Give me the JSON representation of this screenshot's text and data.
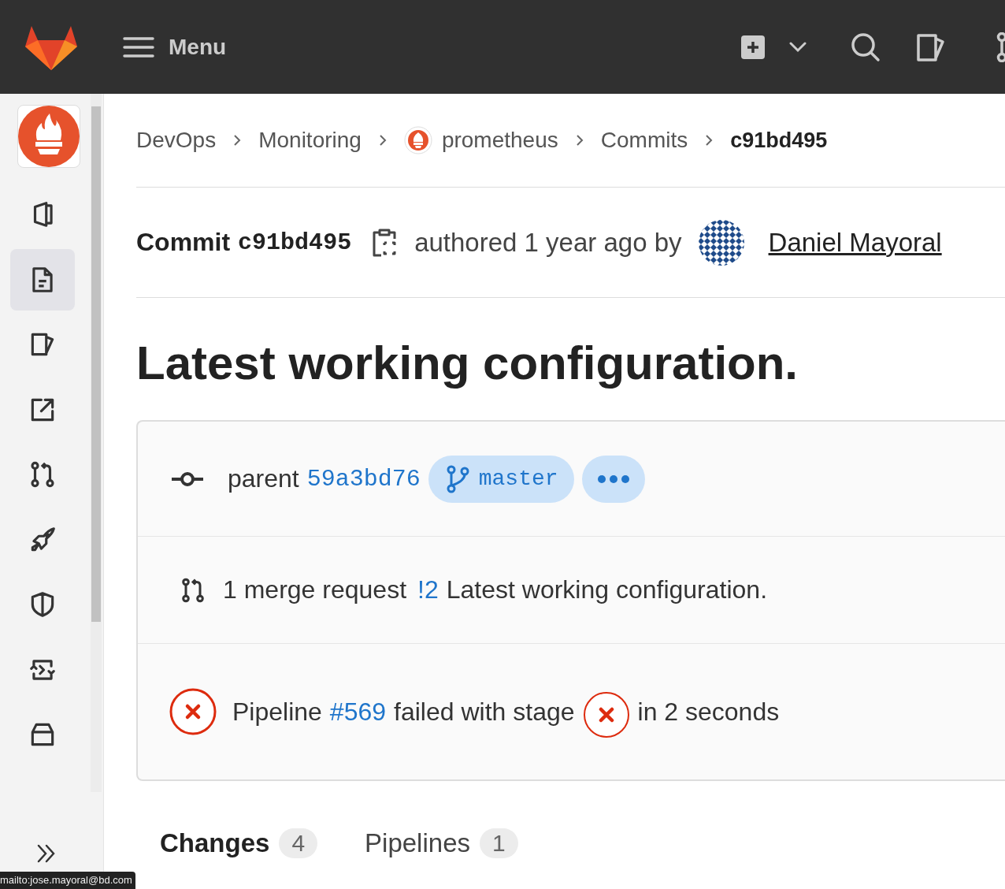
{
  "topbar": {
    "menu_label": "Menu"
  },
  "sidebar": {
    "items": [
      {
        "selected": false
      },
      {
        "selected": true
      },
      {
        "selected": false
      },
      {
        "selected": false
      },
      {
        "selected": false
      },
      {
        "selected": false
      },
      {
        "selected": false
      },
      {
        "selected": false
      },
      {
        "selected": false
      }
    ]
  },
  "breadcrumbs": [
    {
      "label": "DevOps",
      "kind": "link"
    },
    {
      "label": "Monitoring",
      "kind": "link"
    },
    {
      "label": "prometheus",
      "kind": "project"
    },
    {
      "label": "Commits",
      "kind": "link"
    },
    {
      "label": "c91bd495",
      "kind": "current"
    }
  ],
  "commit_header": {
    "label": "Commit",
    "sha": "c91bd495",
    "authored": "authored 1 year ago by",
    "author": "Daniel Mayoral"
  },
  "title": "Latest working configuration.",
  "info": {
    "parent_label": "parent",
    "parent_sha": "59a3bd76",
    "branch": "master",
    "merge_count": "1 merge request",
    "mr_ref": "!2",
    "mr_title": "Latest working configuration.",
    "pipeline_label": "Pipeline",
    "pipeline_ref": "#569",
    "pipeline_status": "failed with stage",
    "pipeline_duration": "in 2 seconds"
  },
  "tabs": [
    {
      "label": "Changes",
      "count": "4",
      "selected": true
    },
    {
      "label": "Pipelines",
      "count": "1",
      "selected": false
    }
  ],
  "status_link": "mailto:jose.mayoral@bd.com"
}
